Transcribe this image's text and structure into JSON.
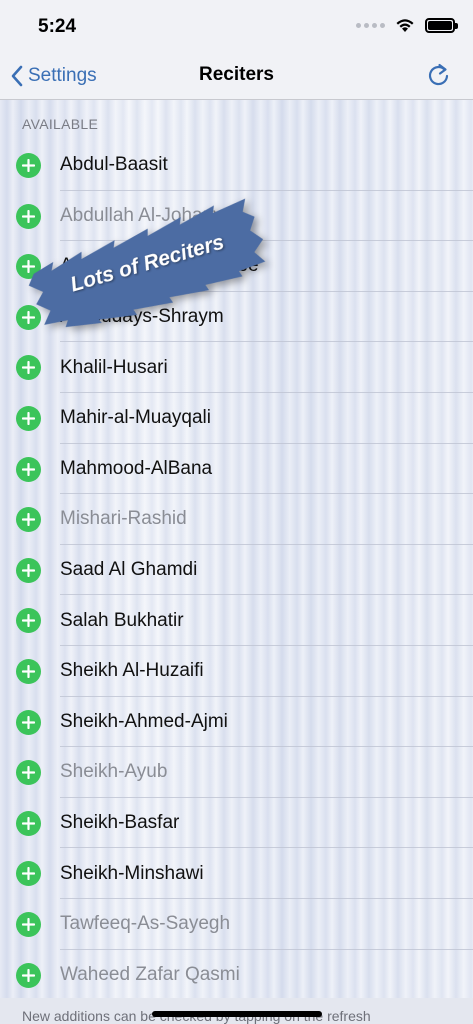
{
  "status_bar": {
    "time": "5:24",
    "icons": [
      "signal-dots-icon",
      "wifi-icon",
      "battery-icon"
    ]
  },
  "nav": {
    "back_label": "Settings",
    "title": "Reciters",
    "right_icon": "refresh-icon",
    "accent_color": "#3a6fb5"
  },
  "section": {
    "header": "AVAILABLE"
  },
  "reciters": [
    {
      "name": "Abdul-Baasit",
      "dim": false
    },
    {
      "name": "Abdullah Al-Johany",
      "dim": true
    },
    {
      "name": "Abu Bakr Ash-Shaatree",
      "dim": false
    },
    {
      "name": "As-Sudays-Shraym",
      "dim": false
    },
    {
      "name": "Khalil-Husari",
      "dim": false
    },
    {
      "name": "Mahir-al-Muayqali",
      "dim": false
    },
    {
      "name": "Mahmood-AlBana",
      "dim": false
    },
    {
      "name": "Mishari-Rashid",
      "dim": true
    },
    {
      "name": "Saad Al Ghamdi",
      "dim": false
    },
    {
      "name": "Salah Bukhatir",
      "dim": false
    },
    {
      "name": "Sheikh Al-Huzaifi",
      "dim": false
    },
    {
      "name": "Sheikh-Ahmed-Ajmi",
      "dim": false
    },
    {
      "name": "Sheikh-Ayub",
      "dim": true
    },
    {
      "name": "Sheikh-Basfar",
      "dim": false
    },
    {
      "name": "Sheikh-Minshawi",
      "dim": false
    },
    {
      "name": "Tawfeeq-As-Sayegh",
      "dim": true
    },
    {
      "name": "Waheed Zafar Qasmi",
      "dim": true
    }
  ],
  "add_icon_color": "#3bc45a",
  "banner": {
    "text": "Lots of Reciters",
    "color": "#4c6ca3"
  },
  "footer": {
    "note": "New additions can be checked by tapping on the refresh"
  }
}
